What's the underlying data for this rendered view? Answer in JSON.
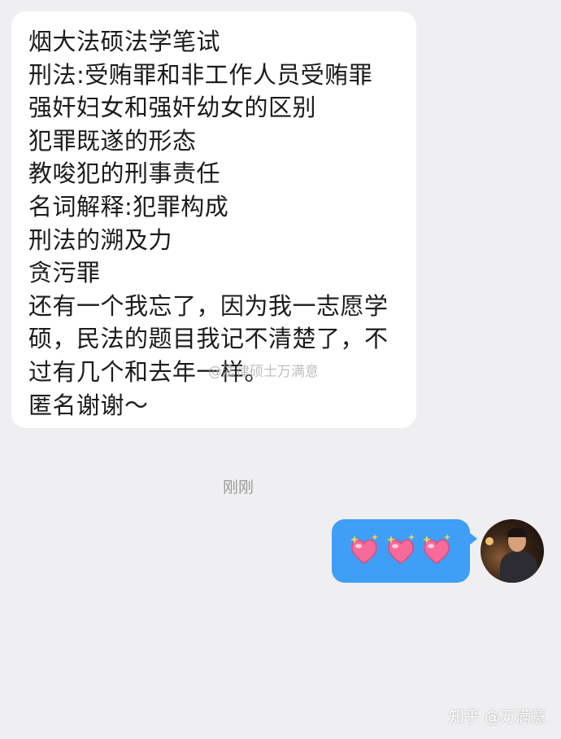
{
  "chat": {
    "incoming_lines": [
      "烟大法硕法学笔试",
      "刑法:受贿罪和非工作人员受贿罪",
      "强奸妇女和强奸幼女的区别",
      "犯罪既遂的形态",
      "教唆犯的刑事责任",
      "名词解释:犯罪构成",
      "刑法的溯及力",
      "贪污罪",
      "还有一个我忘了，因为我一志愿学",
      "硕，民法的题目我记不清楚了，不",
      "过有几个和去年一样。",
      "匿名谢谢～"
    ],
    "watermark": "@法律硕士万满意",
    "timestamp": "刚刚",
    "outgoing": {
      "content": "three sparkling pink heart emoji",
      "icons": [
        "sparkling-heart-icon",
        "sparkling-heart-icon",
        "sparkling-heart-icon"
      ],
      "bubble_color": "#3f9ef6"
    }
  },
  "footer": {
    "brand": "知乎 @万满意"
  },
  "colors": {
    "background": "#efeff1",
    "incoming_bubble": "#ffffff",
    "outgoing_bubble": "#3f9ef6",
    "heart": "#f76b9a"
  }
}
